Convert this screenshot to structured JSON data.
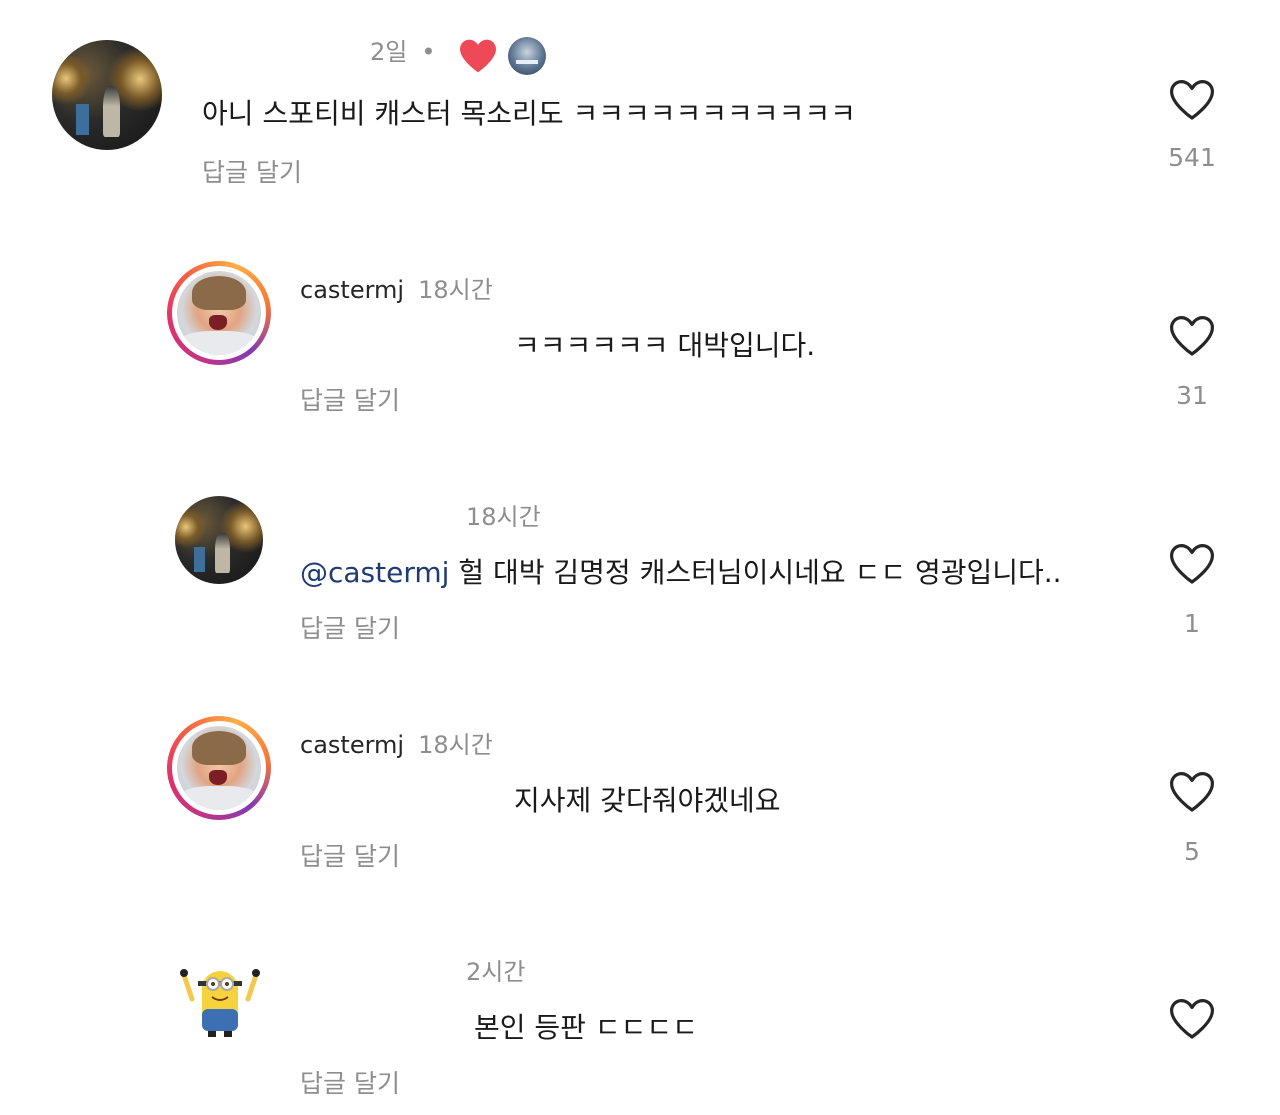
{
  "comments": [
    {
      "time": "2일",
      "text": "아니 스포티비 캐스터 목소리도 ㅋㅋㅋㅋㅋㅋㅋㅋㅋㅋㅋ",
      "reply_label": "답글 달기",
      "like_count": "541",
      "liked_by_creator": true
    },
    {
      "username": "castermj",
      "time": "18시간",
      "text": "ㅋㅋㅋㅋㅋㅋ 대박입니다.",
      "reply_label": "답글 달기",
      "like_count": "31"
    },
    {
      "time": "18시간",
      "mention": "@castermj",
      "text": " 헐 대박 김명정 캐스터님이시네요 ㄷㄷ 영광입니다..",
      "reply_label": "답글 달기",
      "like_count": "1"
    },
    {
      "username": "castermj",
      "time": "18시간",
      "text": "지사제 갖다줘야겠네요",
      "reply_label": "답글 달기",
      "like_count": "5"
    },
    {
      "time": "2시간",
      "text": "본인 등판 ㄷㄷㄷㄷ",
      "reply_label": "답글 달기"
    }
  ],
  "colors": {
    "like_red": "#ed4956",
    "mention": "#1f3b73",
    "muted": "#8e8e8e"
  },
  "icons": {
    "like": "heart-outline-icon",
    "creator_like": "heart-filled-icon"
  }
}
